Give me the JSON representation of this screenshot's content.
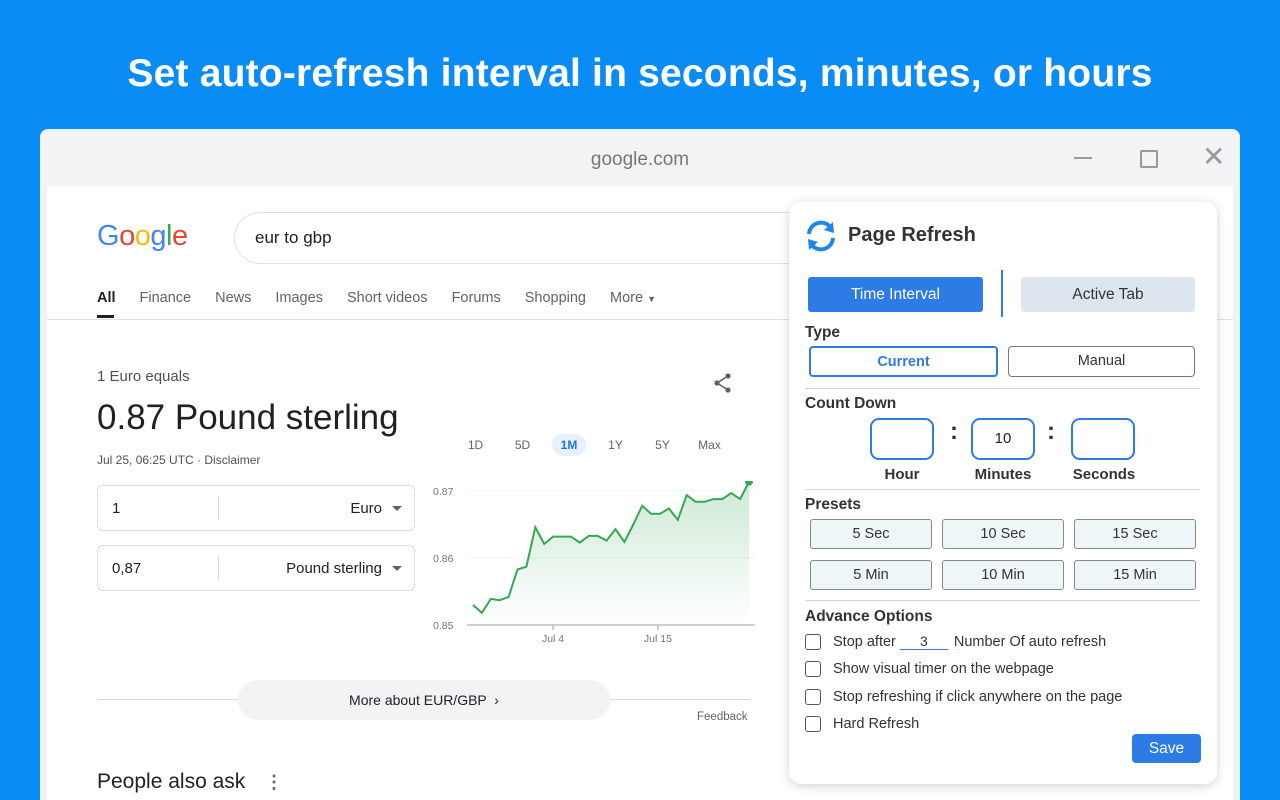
{
  "headline": "Set auto-refresh interval in seconds, minutes, or hours",
  "window": {
    "title": "google.com"
  },
  "google": {
    "logo": [
      "G",
      "o",
      "o",
      "g",
      "l",
      "e"
    ],
    "logo_colors": [
      "#4285f4",
      "#ea4335",
      "#fbbc05",
      "#4285f4",
      "#34a853",
      "#ea4335"
    ],
    "search_value": "eur to gbp",
    "tabs": [
      "All",
      "Finance",
      "News",
      "Images",
      "Short videos",
      "Forums",
      "Shopping",
      "More"
    ],
    "conversion": {
      "subtitle": "1 Euro equals",
      "result": "0.87 Pound sterling",
      "date": "Jul 25, 06:25 UTC · Disclaimer",
      "from_value": "1",
      "from_unit": "Euro",
      "to_value": "0,87",
      "to_unit": "Pound sterling"
    },
    "ranges": [
      "1D",
      "5D",
      "1M",
      "1Y",
      "5Y",
      "Max"
    ],
    "active_range": "1M",
    "more_button": "More about EUR/GBP",
    "feedback": "Feedback",
    "people_also_ask": "People also ask"
  },
  "chart_data": {
    "type": "area",
    "y_ticks": [
      "0.87",
      "0.86",
      "0.85"
    ],
    "ylim": [
      0.85,
      0.8715
    ],
    "x_ticks": [
      "Jul 4",
      "Jul 15"
    ],
    "x": [
      0,
      1,
      2,
      3,
      4,
      5,
      6,
      7,
      8,
      9,
      10,
      11,
      12,
      13,
      14,
      15,
      16,
      17,
      18,
      19,
      20,
      21,
      22,
      23,
      24,
      25,
      26,
      27,
      28,
      29,
      30,
      31,
      32,
      33,
      34,
      35,
      36,
      37,
      38
    ],
    "values": [
      0.853,
      0.8518,
      0.8539,
      0.8537,
      0.8542,
      0.8583,
      0.8587,
      0.8646,
      0.8621,
      0.8632,
      0.8632,
      0.8632,
      0.8623,
      0.8633,
      0.8633,
      0.8626,
      0.8643,
      0.8624,
      0.865,
      0.8678,
      0.8666,
      0.8666,
      0.8674,
      0.8657,
      0.8694,
      0.8684,
      0.8684,
      0.8688,
      0.8688,
      0.8697,
      0.8688,
      0.8714
    ],
    "line_color": "#34a853"
  },
  "extension": {
    "title": "Page Refresh",
    "tab_time": "Time Interval",
    "tab_active": "Active Tab",
    "type_label": "Type",
    "type_current": "Current",
    "type_manual": "Manual",
    "countdown_label": "Count Down",
    "hour_value": "",
    "minutes_value": "10",
    "seconds_value": "",
    "hour_label": "Hour",
    "minutes_label": "Minutes",
    "seconds_label": "Seconds",
    "presets_label": "Presets",
    "presets": [
      "5 Sec",
      "10 Sec",
      "15 Sec",
      "5 Min",
      "10 Min",
      "15 Min"
    ],
    "advance_label": "Advance Options",
    "stop_after_prefix": "Stop after",
    "stop_after_value": "3",
    "stop_after_suffix": "Number Of auto refresh",
    "opt_visual": "Show visual timer on the webpage",
    "opt_click": "Stop refreshing if click anywhere on the page",
    "opt_hard": "Hard Refresh",
    "save": "Save",
    "accent": "#2d7be5"
  }
}
